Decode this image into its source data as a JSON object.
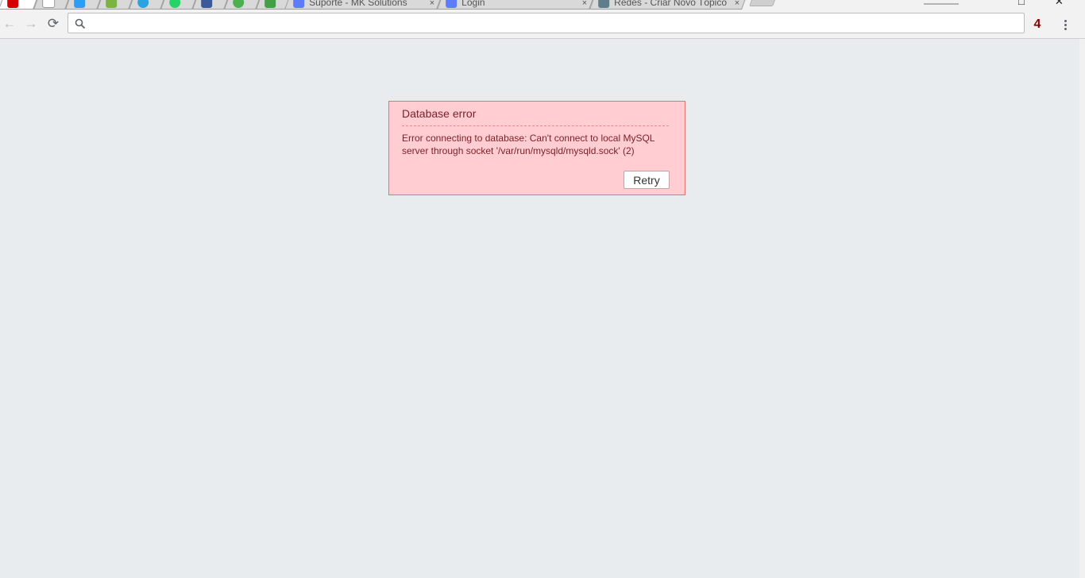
{
  "browser": {
    "tabs": [
      {
        "title": "",
        "favicon": "zabbix-icon",
        "color": "#d40000",
        "active": true
      },
      {
        "title": "",
        "favicon": "blank-page-icon",
        "color": "#bdbdbd",
        "active": false
      },
      {
        "title": "",
        "favicon": "star-icon",
        "color": "#2a9df4",
        "active": false
      },
      {
        "title": "",
        "favicon": "chart-icon",
        "color": "#7cb342",
        "active": false
      },
      {
        "title": "",
        "favicon": "telegram-icon",
        "color": "#2aa3e0",
        "active": false
      },
      {
        "title": "",
        "favicon": "whatsapp-icon",
        "color": "#25d366",
        "active": false
      },
      {
        "title": "",
        "favicon": "facebook-icon",
        "color": "#3b5998",
        "active": false
      },
      {
        "title": "",
        "favicon": "globe-icon",
        "color": "#4caf50",
        "active": false
      },
      {
        "title": "",
        "favicon": "pdf-icon",
        "color": "#43a047",
        "active": false
      },
      {
        "title": "Suporte - MK Solutions",
        "favicon": "chart-icon",
        "color": "#5c7cfa",
        "active": false
      },
      {
        "title": "Login",
        "favicon": "zabbix-icon",
        "color": "#5c7cfa",
        "active": false
      },
      {
        "title": "Redes - Criar Novo Tópico",
        "favicon": "tools-icon",
        "color": "#607d8b",
        "active": false
      }
    ],
    "close_glyph": "×",
    "window_controls": {
      "minimize": "–",
      "maximize": "□",
      "close": "✕"
    }
  },
  "toolbar": {
    "back_icon": "←",
    "forward_icon": "→",
    "reload_icon": "⟳",
    "address_value": "",
    "address_placeholder": "",
    "extension_badge": "4"
  },
  "error": {
    "title": "Database error",
    "message": "Error connecting to database: Can't connect to local MySQL server through socket '/var/run/mysqld/mysqld.sock' (2)",
    "retry_label": "Retry"
  },
  "colors": {
    "page_background": "#e9ecef",
    "error_background": "#ffcdd2",
    "error_border": "#e57373",
    "error_text": "#7a1f27"
  }
}
